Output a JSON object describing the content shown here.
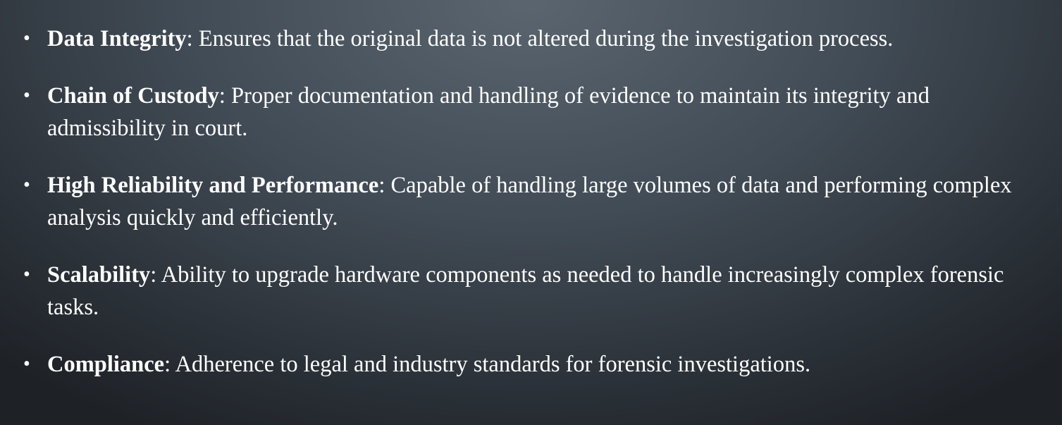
{
  "items": [
    {
      "term": "Data Integrity",
      "text": ": Ensures that the original data is not altered during the investigation process."
    },
    {
      "term": "Chain of Custody",
      "text": ": Proper documentation and handling of evidence to maintain its integrity and admissibility in court."
    },
    {
      "term": "High Reliability and Performance",
      "text": ": Capable of handling large volumes of data and performing complex analysis quickly and efficiently."
    },
    {
      "term": "Scalability",
      "text": ": Ability to upgrade hardware components as needed to handle increasingly complex forensic tasks."
    },
    {
      "term": "Compliance",
      "text": ": Adherence to legal and industry standards for forensic investigations."
    }
  ]
}
